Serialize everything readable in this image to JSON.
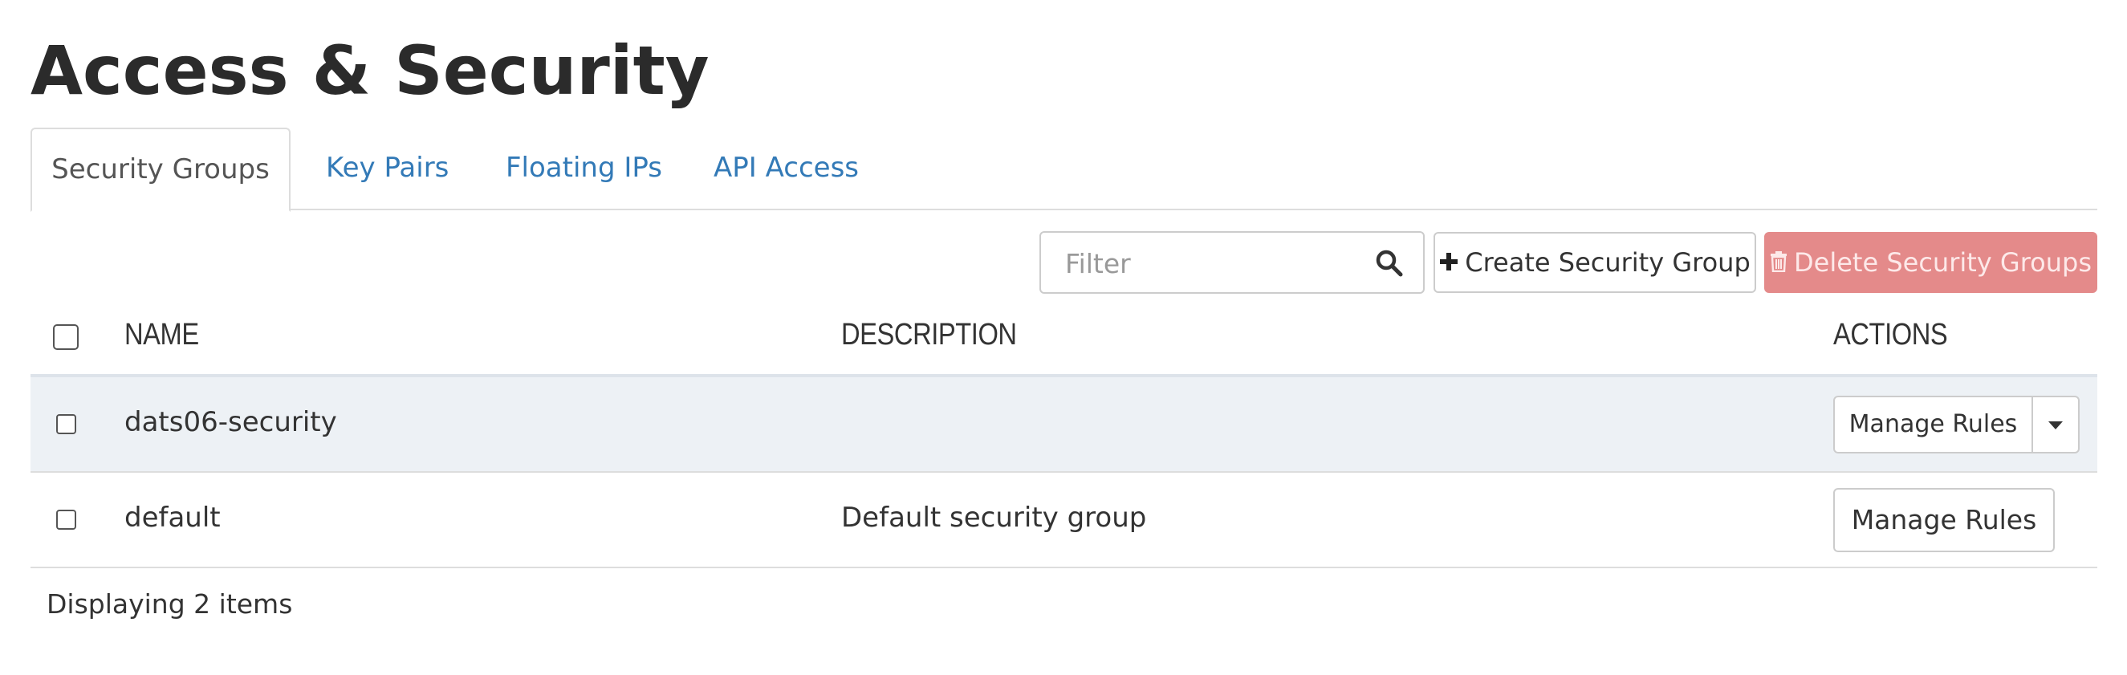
{
  "page": {
    "title": "Access & Security"
  },
  "tabs": [
    {
      "label": "Security Groups",
      "active": true
    },
    {
      "label": "Key Pairs",
      "active": false
    },
    {
      "label": "Floating IPs",
      "active": false
    },
    {
      "label": "API Access",
      "active": false
    }
  ],
  "toolbar": {
    "filter_placeholder": "Filter",
    "filter_value": "",
    "search_icon": "search-icon",
    "create_label": "Create Security Group",
    "create_icon": "plus-icon",
    "delete_label": "Delete Security Groups",
    "delete_icon": "trash-icon",
    "delete_color": "#e48a8a"
  },
  "table": {
    "columns": [
      "NAME",
      "DESCRIPTION",
      "ACTIONS"
    ],
    "rows": [
      {
        "name": "dats06-security",
        "description": "",
        "action_label": "Manage Rules",
        "has_dropdown": true
      },
      {
        "name": "default",
        "description": "Default security group",
        "action_label": "Manage Rules",
        "has_dropdown": false
      }
    ],
    "footer": "Displaying 2 items"
  },
  "colors": {
    "link": "#337ab7",
    "row_highlight": "#edf1f5"
  }
}
